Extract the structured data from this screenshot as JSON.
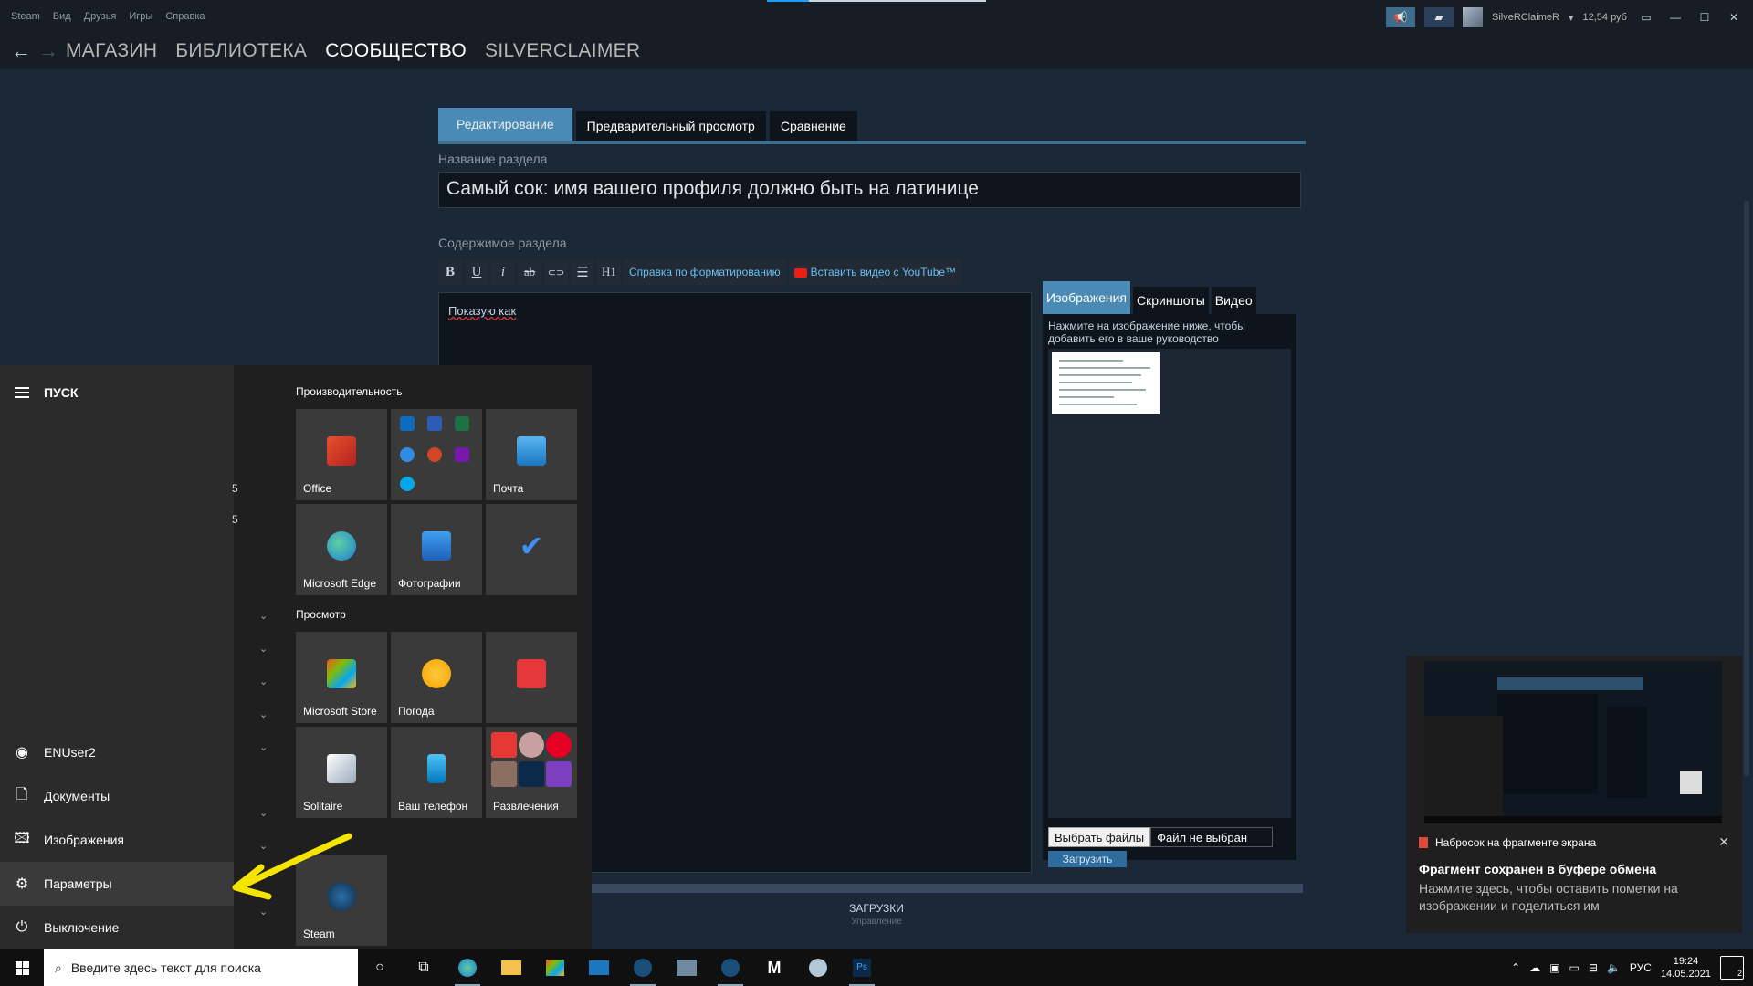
{
  "steam_menu": [
    "Steam",
    "Вид",
    "Друзья",
    "Игры",
    "Справка"
  ],
  "account": {
    "name": "SilveRClaimeR",
    "balance": "12,54 руб"
  },
  "nav": {
    "store": "МАГАЗИН",
    "library": "БИБЛИОТЕКА",
    "community": "СООБЩЕСТВО",
    "user": "SILVERCLAIMER"
  },
  "editor": {
    "tabs": [
      "Редактирование",
      "Предварительный просмотр",
      "Сравнение"
    ],
    "section_name_label": "Название раздела",
    "section_name_value": "Самый сок: имя вашего профиля должно быть на латинице",
    "section_content_label": "Содержимое раздела",
    "format_buttons": [
      "B",
      "U",
      "i",
      "ab",
      "⊂⊃",
      "☰",
      "H1"
    ],
    "format_help": "Справка по форматированию",
    "insert_youtube": "Вставить видео с YouTube™",
    "content_text": "Показую как"
  },
  "image_panel": {
    "tabs": [
      "Изображения",
      "Скриншоты",
      "Видео"
    ],
    "hint": "Нажмите на изображение ниже, чтобы добавить его в ваше руководство",
    "choose_files": "Выбрать файлы",
    "no_file": "Файл не выбран",
    "upload": "Загрузить"
  },
  "downloads": {
    "title": "ЗАГРУЗКИ",
    "subtitle": "Управление"
  },
  "start_menu": {
    "header": "ПУСК",
    "user": "ENUser2",
    "documents": "Документы",
    "images": "Изображения",
    "settings": "Параметры",
    "power": "Выключение",
    "group_productivity": "Производительность",
    "group_browse": "Просмотр",
    "tiles": {
      "office": "Office",
      "mail": "Почта",
      "edge": "Microsoft Edge",
      "photos": "Фотографии",
      "store": "Microsoft Store",
      "weather": "Погода",
      "solitaire": "Solitaire",
      "phone": "Ваш телефон",
      "entertainment": "Развлечения",
      "steam": "Steam"
    }
  },
  "notification": {
    "app": "Набросок на фрагменте экрана",
    "title": "Фрагмент сохранен в буфере обмена",
    "body": "Нажмите здесь, чтобы оставить пометки на изображении и поделиться им"
  },
  "taskbar": {
    "search_placeholder": "Введите здесь текст для поиска",
    "lang": "РУС",
    "time": "19:24",
    "date": "14.05.2021",
    "notif_count": "2"
  },
  "colors": {
    "steam_bg": "#1b2838",
    "accent": "#4a8ab4",
    "link": "#66c0f4",
    "highlight_arrow": "#f5e400"
  }
}
